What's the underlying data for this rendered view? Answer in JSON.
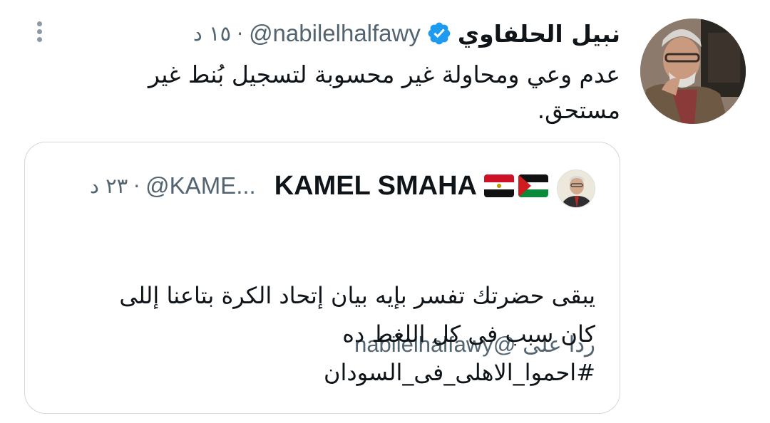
{
  "tweet": {
    "author": {
      "display_name": "نبيل الحلفاوي",
      "handle": "@nabilelhalfawy",
      "verified": true,
      "avatar_icon": "author-avatar"
    },
    "time": "١٥ د",
    "separator": "·",
    "text": "عدم وعي ومحاولة غير محسوبة لتسجيل بُنط غير مستحق.",
    "more_icon": "more-vertical-icon"
  },
  "quoted": {
    "author": {
      "display_name": "KAMEL SMAHA",
      "handle": "@KAME...",
      "flags": [
        "palestine-flag",
        "egypt-flag"
      ]
    },
    "time": "٢٣ د",
    "separator": "·",
    "reply_prefix": "ردا على",
    "reply_handle": "@nabilelhalfawy",
    "lines": [
      "يبقى حضرتك تفسر بإيه بيان إتحاد الكرة بتاعنا إللى",
      "كان سبب فى كل اللغط ده",
      "#احموا_الاهلى_فى_السودان"
    ]
  },
  "colors": {
    "text_primary": "#0f1419",
    "text_secondary": "#536471",
    "border": "#cfd9de",
    "verified_blue": "#1d9bf0"
  }
}
